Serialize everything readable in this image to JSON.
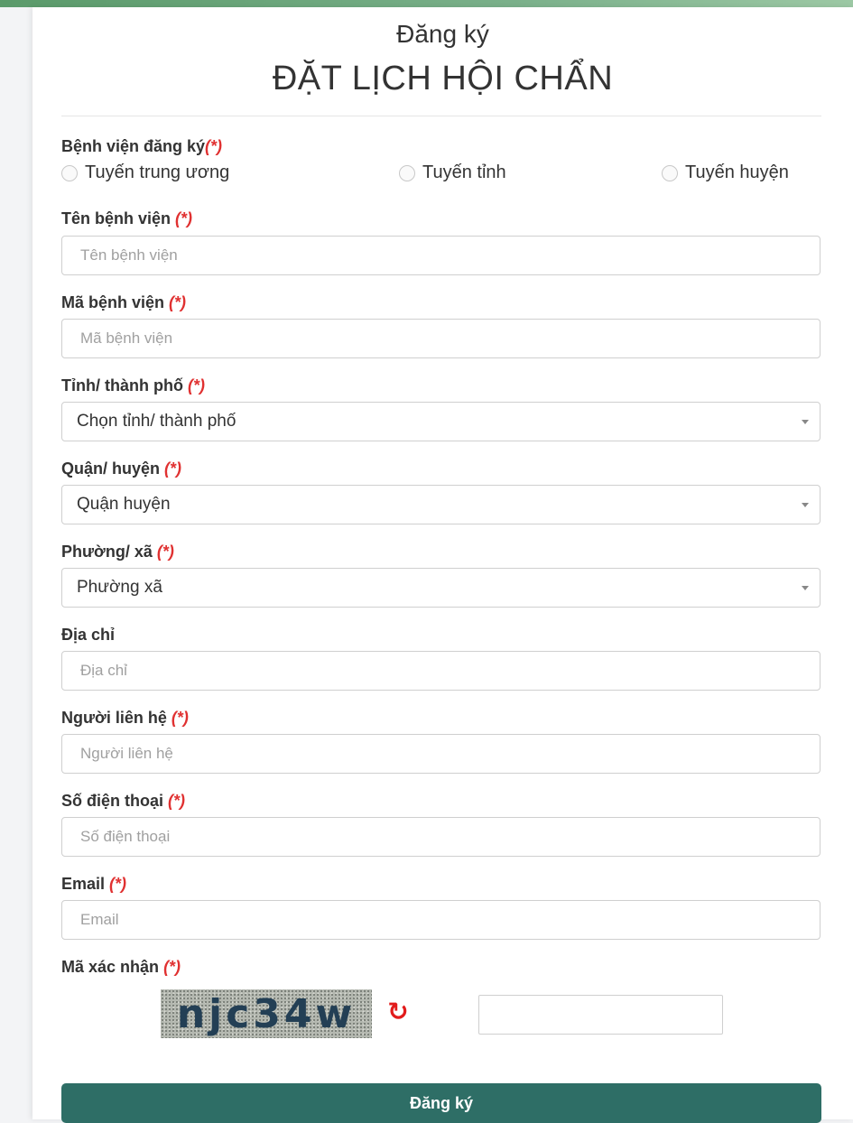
{
  "header": {
    "subtitle": "Đăng ký",
    "title": "ĐẶT LỊCH HỘI CHẨN"
  },
  "required_mark": "(*)",
  "hospital_level": {
    "label": "Bệnh viện đăng ký",
    "options": [
      "Tuyến trung ương",
      "Tuyến tỉnh",
      "Tuyến huyện"
    ]
  },
  "hospital_name": {
    "label": "Tên bệnh viện",
    "placeholder": "Tên bệnh viện",
    "value": ""
  },
  "hospital_code": {
    "label": "Mã bệnh viện",
    "placeholder": "Mã bệnh viện",
    "value": ""
  },
  "province": {
    "label": "Tỉnh/ thành phố",
    "selected": "Chọn tỉnh/ thành phố"
  },
  "district": {
    "label": "Quận/ huyện",
    "selected": "Quận huyện"
  },
  "ward": {
    "label": "Phường/ xã",
    "selected": "Phường xã"
  },
  "address": {
    "label": "Địa chỉ",
    "placeholder": "Địa chỉ",
    "value": ""
  },
  "contact": {
    "label": "Người liên hệ",
    "placeholder": "Người liên hệ",
    "value": ""
  },
  "phone": {
    "label": "Số điện thoại",
    "placeholder": "Số điện thoại",
    "value": ""
  },
  "email": {
    "label": "Email",
    "placeholder": "Email",
    "value": ""
  },
  "captcha": {
    "label": "Mã xác nhận",
    "image_text": "njc34w",
    "refresh_icon": "refresh-icon",
    "value": ""
  },
  "submit_label": "Đăng ký",
  "colors": {
    "primary": "#2e6e66",
    "required": "#e03131",
    "refresh": "#e21c1c",
    "top_bar": "#7ab08a"
  }
}
